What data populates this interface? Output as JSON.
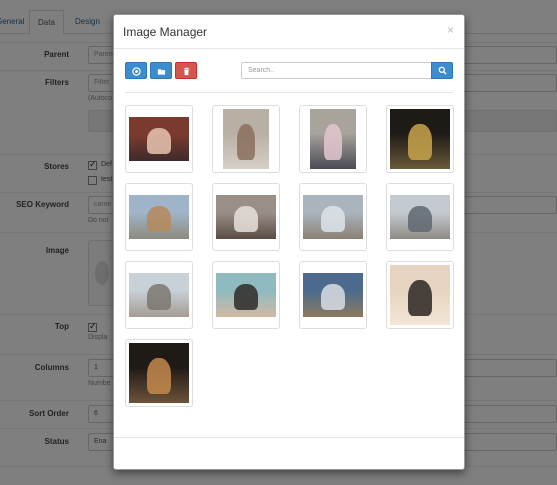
{
  "background": {
    "tabs": [
      "General",
      "Data",
      "Design"
    ],
    "fields": [
      {
        "label": "Parent",
        "value": "Paren"
      },
      {
        "label": "Filters",
        "value": "Filter",
        "help": "(Autoco"
      },
      {
        "label": "Stores",
        "checks": [
          "Def",
          "test"
        ]
      },
      {
        "label": "SEO Keyword",
        "value": "came",
        "help": "Do not"
      },
      {
        "label": "Image"
      },
      {
        "label": "Top",
        "help": "Displa"
      },
      {
        "label": "Columns",
        "value": "1",
        "help": "Numbe"
      },
      {
        "label": "Sort Order",
        "value": "6"
      },
      {
        "label": "Status",
        "value": "Ena"
      }
    ]
  },
  "modal": {
    "title": "Image Manager",
    "close": "×",
    "toolbar": {
      "upload_icon": "upload-icon",
      "folder_icon": "folder-icon",
      "delete_icon": "trash-icon"
    },
    "search": {
      "placeholder": "Search.."
    },
    "images": [
      {
        "name": "baby-portrait",
        "kind": "landscape",
        "colors": [
          "#7a3b2e",
          "#e8c4b0",
          "#3d2b2b"
        ]
      },
      {
        "name": "girl-in-shop",
        "kind": "portrait",
        "colors": [
          "#b9b0a5",
          "#8a6e5c",
          "#d6cfc5"
        ]
      },
      {
        "name": "girl-pink-dress",
        "kind": "portrait",
        "colors": [
          "#a8a39b",
          "#e3c7d0",
          "#4b4b55"
        ]
      },
      {
        "name": "couple-dark",
        "kind": "square",
        "colors": [
          "#1e1a16",
          "#c9a44c",
          "#6b5a3a"
        ]
      },
      {
        "name": "beach-building",
        "kind": "landscape",
        "colors": [
          "#9fb4c8",
          "#b58a5a",
          "#8e8a80"
        ]
      },
      {
        "name": "child-on-sand",
        "kind": "landscape",
        "colors": [
          "#9a8f86",
          "#e7e2dc",
          "#5a4c44"
        ]
      },
      {
        "name": "child-on-beach",
        "kind": "landscape",
        "colors": [
          "#aab4bd",
          "#dde4ea",
          "#8c8074"
        ]
      },
      {
        "name": "beach-shoreline",
        "kind": "landscape",
        "colors": [
          "#c3cad0",
          "#5f6770",
          "#8f8a84"
        ]
      },
      {
        "name": "beach-flat",
        "kind": "landscape",
        "colors": [
          "#c8d0d8",
          "#7d7770",
          "#a49c92"
        ]
      },
      {
        "name": "women-group",
        "kind": "landscape",
        "colors": [
          "#8fbac0",
          "#2e2a28",
          "#d2b9a4"
        ]
      },
      {
        "name": "cloudy-sky",
        "kind": "landscape",
        "colors": [
          "#4c6a8e",
          "#d9dde4",
          "#8c7a5e"
        ]
      },
      {
        "name": "women-selfie",
        "kind": "square",
        "colors": [
          "#e7d4c0",
          "#2a2522",
          "#f3e6d6"
        ]
      },
      {
        "name": "group-selfie-dark",
        "kind": "square",
        "colors": [
          "#1f1a15",
          "#c48a4c",
          "#6c5339"
        ]
      }
    ]
  }
}
